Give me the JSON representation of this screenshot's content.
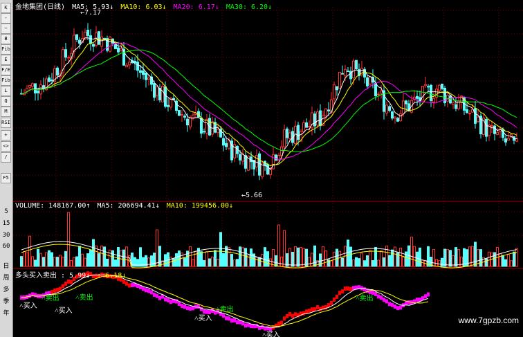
{
  "toolbar": {
    "buttons": [
      "K",
      "-",
      "~",
      "B",
      "Fib",
      "E",
      "F/E",
      "Fib",
      "L",
      "Q",
      "M",
      "RSI",
      "+",
      "<>",
      "/",
      "F5"
    ],
    "axis_labels": [
      "5",
      "15",
      "30",
      "60"
    ],
    "period_labels": [
      "日",
      "周",
      "多",
      "季",
      "年"
    ]
  },
  "price_header": {
    "name": "金地集团(日线)",
    "ma5": "MA5: 5.93↓",
    "ma10": "MA10: 6.03↓",
    "ma20": "MA20: 6.17↓",
    "ma30": "MA30: 6.20↓"
  },
  "volume_header": {
    "volume": "VOLUME: 148167.00↑",
    "ma5": "MA5: 206694.41↓",
    "ma10": "MA10: 199456.00↓"
  },
  "indicator_header": {
    "name": "多头买入卖出 : 5.99↓",
    "value": ": 6.18↓"
  },
  "annotations": {
    "high": "7.17",
    "low": "5.66",
    "buy": "买入",
    "sell": "卖出"
  },
  "watermark": "www.7gpzb.com",
  "colors": {
    "up": "#ff3030",
    "down": "#54ffff",
    "ma5": "#ffffff",
    "ma10": "#ffff00",
    "ma20": "#ff00ff",
    "ma30": "#00ff00",
    "grid": "#7a0000",
    "bull": "#ff0000",
    "bear": "#ff00ff"
  }
}
